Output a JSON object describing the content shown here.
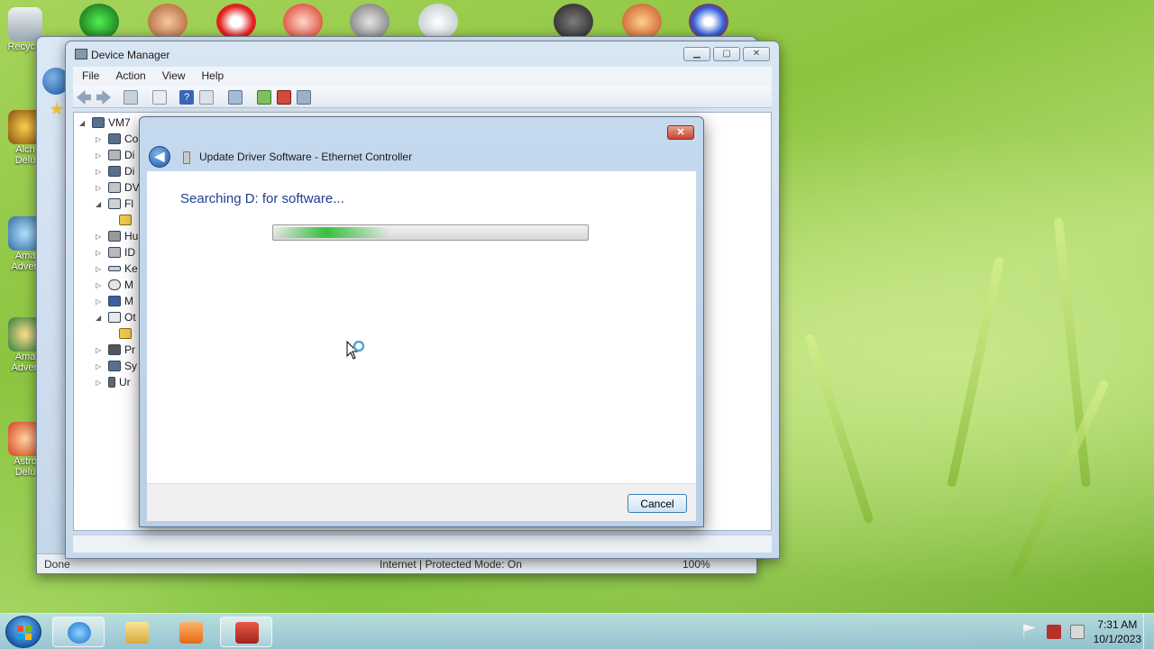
{
  "desktop": {
    "left_icons": [
      {
        "label": "Recycle",
        "icon": "recycle-bin-icon"
      },
      {
        "label": "Alch\nDelu",
        "icon": "alchemy-icon"
      },
      {
        "label": "Ama\nAdven",
        "icon": "amazing-adventures-icon"
      },
      {
        "label": "Ama\nAdven",
        "icon": "amazing-adventures-2-icon"
      },
      {
        "label": "Astro\nDelu",
        "icon": "astro-icon"
      }
    ],
    "top_icons": [
      "green-game-icon",
      "girl-face-icon",
      "red-mushroom-icon",
      "radioactive-icon",
      "robot-icon",
      "white-bird-icon",
      "witch-icon",
      "pizza-icon",
      "blue-orb-icon"
    ]
  },
  "ie_window": {
    "status_left": "Done",
    "status_zone": "Internet | Protected Mode: On",
    "zoom": "100%"
  },
  "device_manager": {
    "title": "Device Manager",
    "menu": [
      "File",
      "Action",
      "View",
      "Help"
    ],
    "tree_root": "VM7",
    "tree_items": [
      {
        "label": "Co",
        "expanded": false
      },
      {
        "label": "Di",
        "expanded": false
      },
      {
        "label": "Di",
        "expanded": false
      },
      {
        "label": "DV",
        "expanded": false
      },
      {
        "label": "Fl",
        "expanded": true
      },
      {
        "label": "",
        "expanded": false,
        "child": true
      },
      {
        "label": "Hu",
        "expanded": false
      },
      {
        "label": "ID",
        "expanded": false
      },
      {
        "label": "Ke",
        "expanded": false
      },
      {
        "label": "M",
        "expanded": false
      },
      {
        "label": "M",
        "expanded": false
      },
      {
        "label": "Ot",
        "expanded": true
      },
      {
        "label": "",
        "expanded": false,
        "child": true
      },
      {
        "label": "Pr",
        "expanded": false
      },
      {
        "label": "Sy",
        "expanded": false
      },
      {
        "label": "Ur",
        "expanded": false
      }
    ]
  },
  "dialog": {
    "title": "Update Driver Software - Ethernet Controller",
    "close_label": "✕",
    "back_label": "◀",
    "message": "Searching D: for software...",
    "progress_note": "indeterminate",
    "cancel_label": "Cancel"
  },
  "taskbar": {
    "items": [
      "internet-explorer-icon",
      "explorer-folder-icon",
      "media-player-icon",
      "toolbox-icon"
    ],
    "time": "7:31 AM",
    "date": "10/1/2023",
    "tray": [
      "action-center-flag-icon",
      "network-icon",
      "volume-muted-icon"
    ]
  },
  "colors": {
    "accent_text": "#1e3f91",
    "progress_green": "#36c13b",
    "close_red": "#c8452f"
  }
}
